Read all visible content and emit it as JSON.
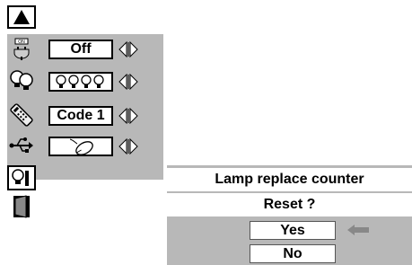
{
  "menu": {
    "up_icon": "up-triangle-icon",
    "items": [
      {
        "icon": "power-plug-icon",
        "value": "Off"
      },
      {
        "icon": "lamp-icon",
        "value": "bulbs-icon"
      },
      {
        "icon": "remote-control-icon",
        "value": "Code 1"
      },
      {
        "icon": "usb-icon",
        "value": "mouse-icon"
      }
    ],
    "lamp_icon": "lamp-reset-icon",
    "exit_icon": "exit-door-icon"
  },
  "dialog": {
    "title": "Lamp replace counter",
    "question": "Reset ?",
    "yes_label": "Yes",
    "no_label": "No",
    "pointer_icon": "left-arrow-icon"
  },
  "colors": {
    "panel": "#b8b8b8",
    "background": "#ffffff",
    "border": "#000000"
  }
}
